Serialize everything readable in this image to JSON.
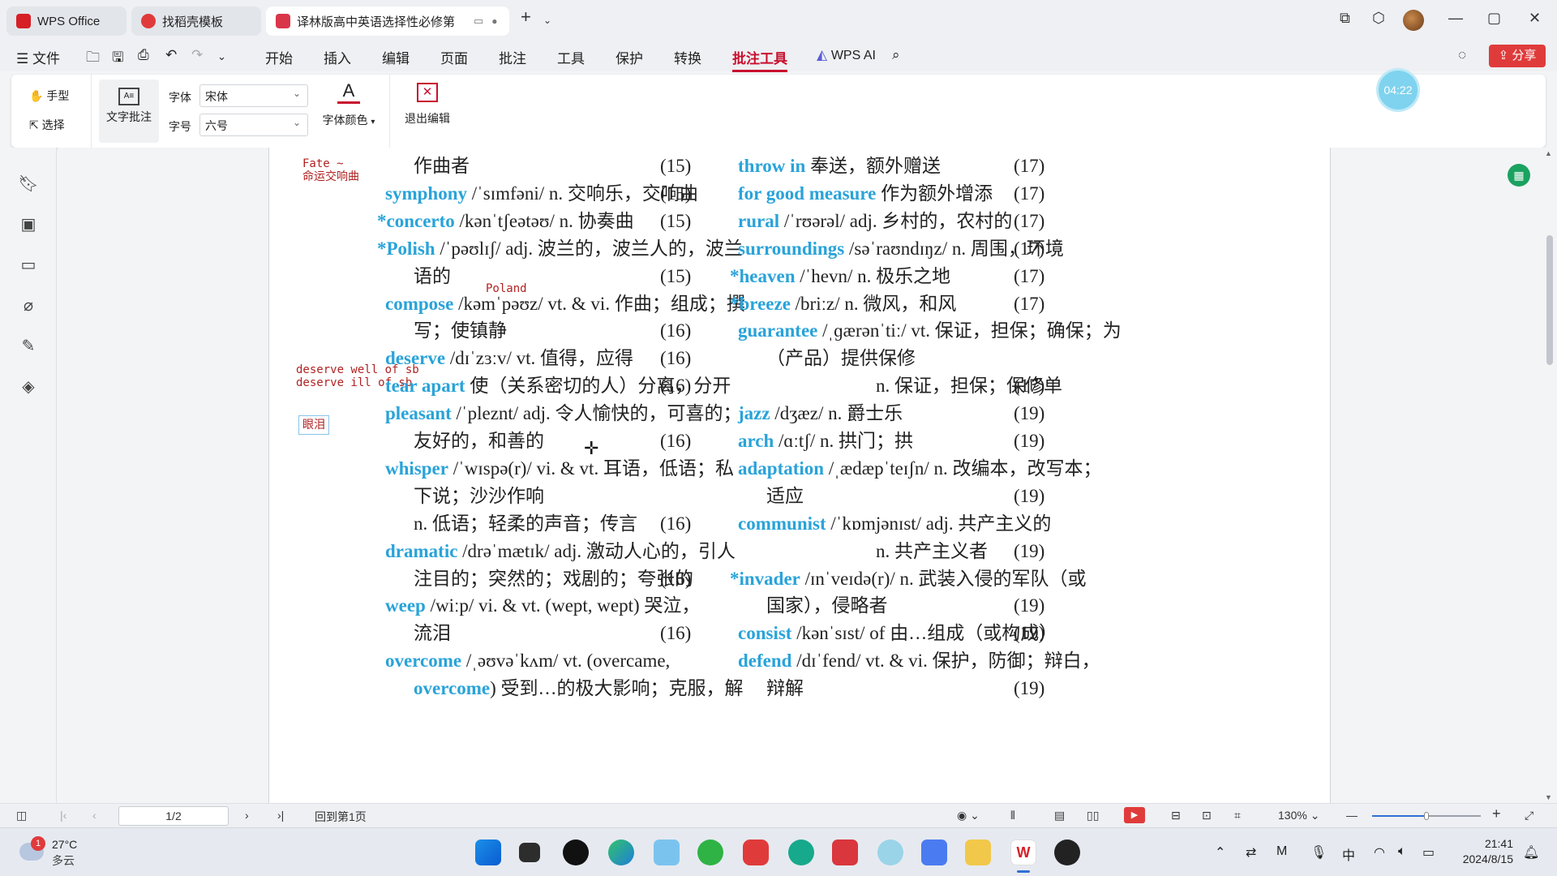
{
  "tabs": [
    {
      "label": "WPS Office"
    },
    {
      "label": "找稻壳模板"
    },
    {
      "label": "译林版高中英语选择性必修第"
    }
  ],
  "menu": {
    "file": "文件",
    "items": [
      "开始",
      "插入",
      "编辑",
      "页面",
      "批注",
      "工具",
      "保护",
      "转换",
      "批注工具"
    ],
    "wps_ai": "WPS AI",
    "share": "分享",
    "timer": "04:22"
  },
  "ribbon": {
    "hand": "手型",
    "select": "选择",
    "text_annot": "文字批注",
    "font_label": "字体",
    "font_value": "宋体",
    "size_label": "字号",
    "size_value": "六号",
    "font_color": "字体颜色",
    "exit_edit": "退出编辑"
  },
  "annotations": {
    "fate": "Fate ~",
    "fate_cn": "命运交响曲",
    "poland": "Poland",
    "deserve1": "deserve well of sb",
    "deserve2": "deserve ill of sb",
    "tears": "眼泪"
  },
  "left_column": [
    {
      "indent": true,
      "word": "",
      "rest": "作曲者",
      "page": "(15)"
    },
    {
      "star": false,
      "word": "symphony",
      "rest": " /ˈsɪmfəni/ n. 交响乐，交响曲",
      "page": "(15)"
    },
    {
      "star": true,
      "word": "concerto",
      "rest": " /kənˈtʃeətəʊ/ n. 协奏曲",
      "page": "(15)"
    },
    {
      "star": true,
      "word": "Polish",
      "rest": " /ˈpəʊlɪʃ/ adj. 波兰的，波兰人的，波兰",
      "page": ""
    },
    {
      "indent": true,
      "word": "",
      "rest": "语的",
      "page": "(15)"
    },
    {
      "star": false,
      "word": "compose",
      "rest": " /kəmˈpəʊz/ vt. & vi. 作曲；组成；撰",
      "page": ""
    },
    {
      "indent": true,
      "word": "",
      "rest": "写；使镇静",
      "page": "(16)"
    },
    {
      "star": false,
      "word": "deserve",
      "rest": " /dɪˈzɜːv/ vt. 值得，应得",
      "page": "(16)"
    },
    {
      "star": false,
      "word": "tear apart",
      "rest": " 使（关系密切的人）分离，分开",
      "page": "(16)"
    },
    {
      "star": false,
      "word": "pleasant",
      "rest": " /ˈpleznt/ adj. 令人愉快的，可喜的；",
      "page": ""
    },
    {
      "indent": true,
      "word": "",
      "rest": "友好的，和善的",
      "page": "(16)"
    },
    {
      "star": false,
      "word": "whisper",
      "rest": " /ˈwɪspə(r)/ vi. & vt. 耳语，低语；私",
      "page": ""
    },
    {
      "indent": true,
      "word": "",
      "rest": "下说；沙沙作响",
      "page": ""
    },
    {
      "indent": true,
      "word": "",
      "rest": "n. 低语；轻柔的声音；传言",
      "page": "(16)"
    },
    {
      "star": false,
      "word": "dramatic",
      "rest": " /drəˈmætɪk/ adj. 激动人心的，引人",
      "page": ""
    },
    {
      "indent": true,
      "word": "",
      "rest": "注目的；突然的；戏剧的；夸张的",
      "page": "(16)"
    },
    {
      "star": false,
      "word": "weep",
      "rest": " /wiːp/ vi. & vt. (wept, wept) 哭泣，",
      "page": ""
    },
    {
      "indent": true,
      "word": "",
      "rest": "流泪",
      "page": "(16)"
    },
    {
      "star": false,
      "word": "overcome",
      "rest": " /ˌəʊvəˈkʌm/ vt. (overcame,",
      "page": ""
    },
    {
      "indent": true,
      "word": "overcome",
      "rest": ") 受到…的极大影响；克服，解",
      "page": ""
    }
  ],
  "right_column": [
    {
      "star": false,
      "word": "throw in",
      "rest": " 奉送，额外赠送",
      "page": "(17)"
    },
    {
      "star": false,
      "word": "for good measure",
      "rest": " 作为额外增添",
      "page": "(17)"
    },
    {
      "star": false,
      "word": "rural",
      "rest": " /ˈrʊərəl/ adj. 乡村的，农村的",
      "page": "(17)"
    },
    {
      "star": false,
      "word": "surroundings",
      "rest": " /səˈraʊndɪŋz/ n. 周围，环境",
      "page": "(17)"
    },
    {
      "star": true,
      "word": "heaven",
      "rest": " /ˈhevn/ n. 极乐之地",
      "page": "(17)"
    },
    {
      "star": true,
      "word": "breeze",
      "rest": " /briːz/ n. 微风，和风",
      "page": "(17)"
    },
    {
      "star": false,
      "word": "guarantee",
      "rest": " /ˌɡærənˈtiː/ vt. 保证，担保；确保；为",
      "page": ""
    },
    {
      "indent": true,
      "word": "",
      "rest": "（产品）提供保修",
      "page": ""
    },
    {
      "indent": true,
      "word": "",
      "rest": "n. 保证，担保；保修单",
      "page": "(17)",
      "farindent": true
    },
    {
      "star": false,
      "word": "jazz",
      "rest": " /dʒæz/ n. 爵士乐",
      "page": "(19)"
    },
    {
      "star": false,
      "word": "arch",
      "rest": " /ɑːtʃ/ n. 拱门；拱",
      "page": "(19)"
    },
    {
      "star": false,
      "word": "adaptation",
      "rest": " /ˌædæpˈteɪʃn/ n. 改编本，改写本；",
      "page": ""
    },
    {
      "indent": true,
      "word": "",
      "rest": "适应",
      "page": "(19)"
    },
    {
      "star": false,
      "word": "communist",
      "rest": " /ˈkɒmjənɪst/ adj. 共产主义的",
      "page": ""
    },
    {
      "indent": true,
      "word": "",
      "rest": "n. 共产主义者",
      "page": "(19)",
      "farindent": true
    },
    {
      "star": true,
      "word": "invader",
      "rest": " /ɪnˈveɪdə(r)/ n. 武装入侵的军队（或",
      "page": ""
    },
    {
      "indent": true,
      "word": "",
      "rest": "国家），侵略者",
      "page": "(19)"
    },
    {
      "star": false,
      "word": "consist",
      "rest": " /kənˈsɪst/ of 由…组成（或构成）",
      "page": "(19)"
    },
    {
      "star": false,
      "word": "defend",
      "rest": " /dɪˈfend/ vt. & vi. 保护，防御；辩白，",
      "page": ""
    },
    {
      "indent": true,
      "word": "",
      "rest": "辩解",
      "page": "(19)"
    }
  ],
  "status": {
    "page": "1/2",
    "back_first": "回到第1页",
    "zoom": "130%"
  },
  "taskbar": {
    "weather_temp": "27°C",
    "weather_desc": "多云",
    "weather_badge": "1",
    "time": "21:41",
    "date": "2024/8/15",
    "ime": "中"
  },
  "colors": {
    "accent": "#c8102e",
    "headword": "#29a3d9",
    "annotation": "#b22222"
  }
}
